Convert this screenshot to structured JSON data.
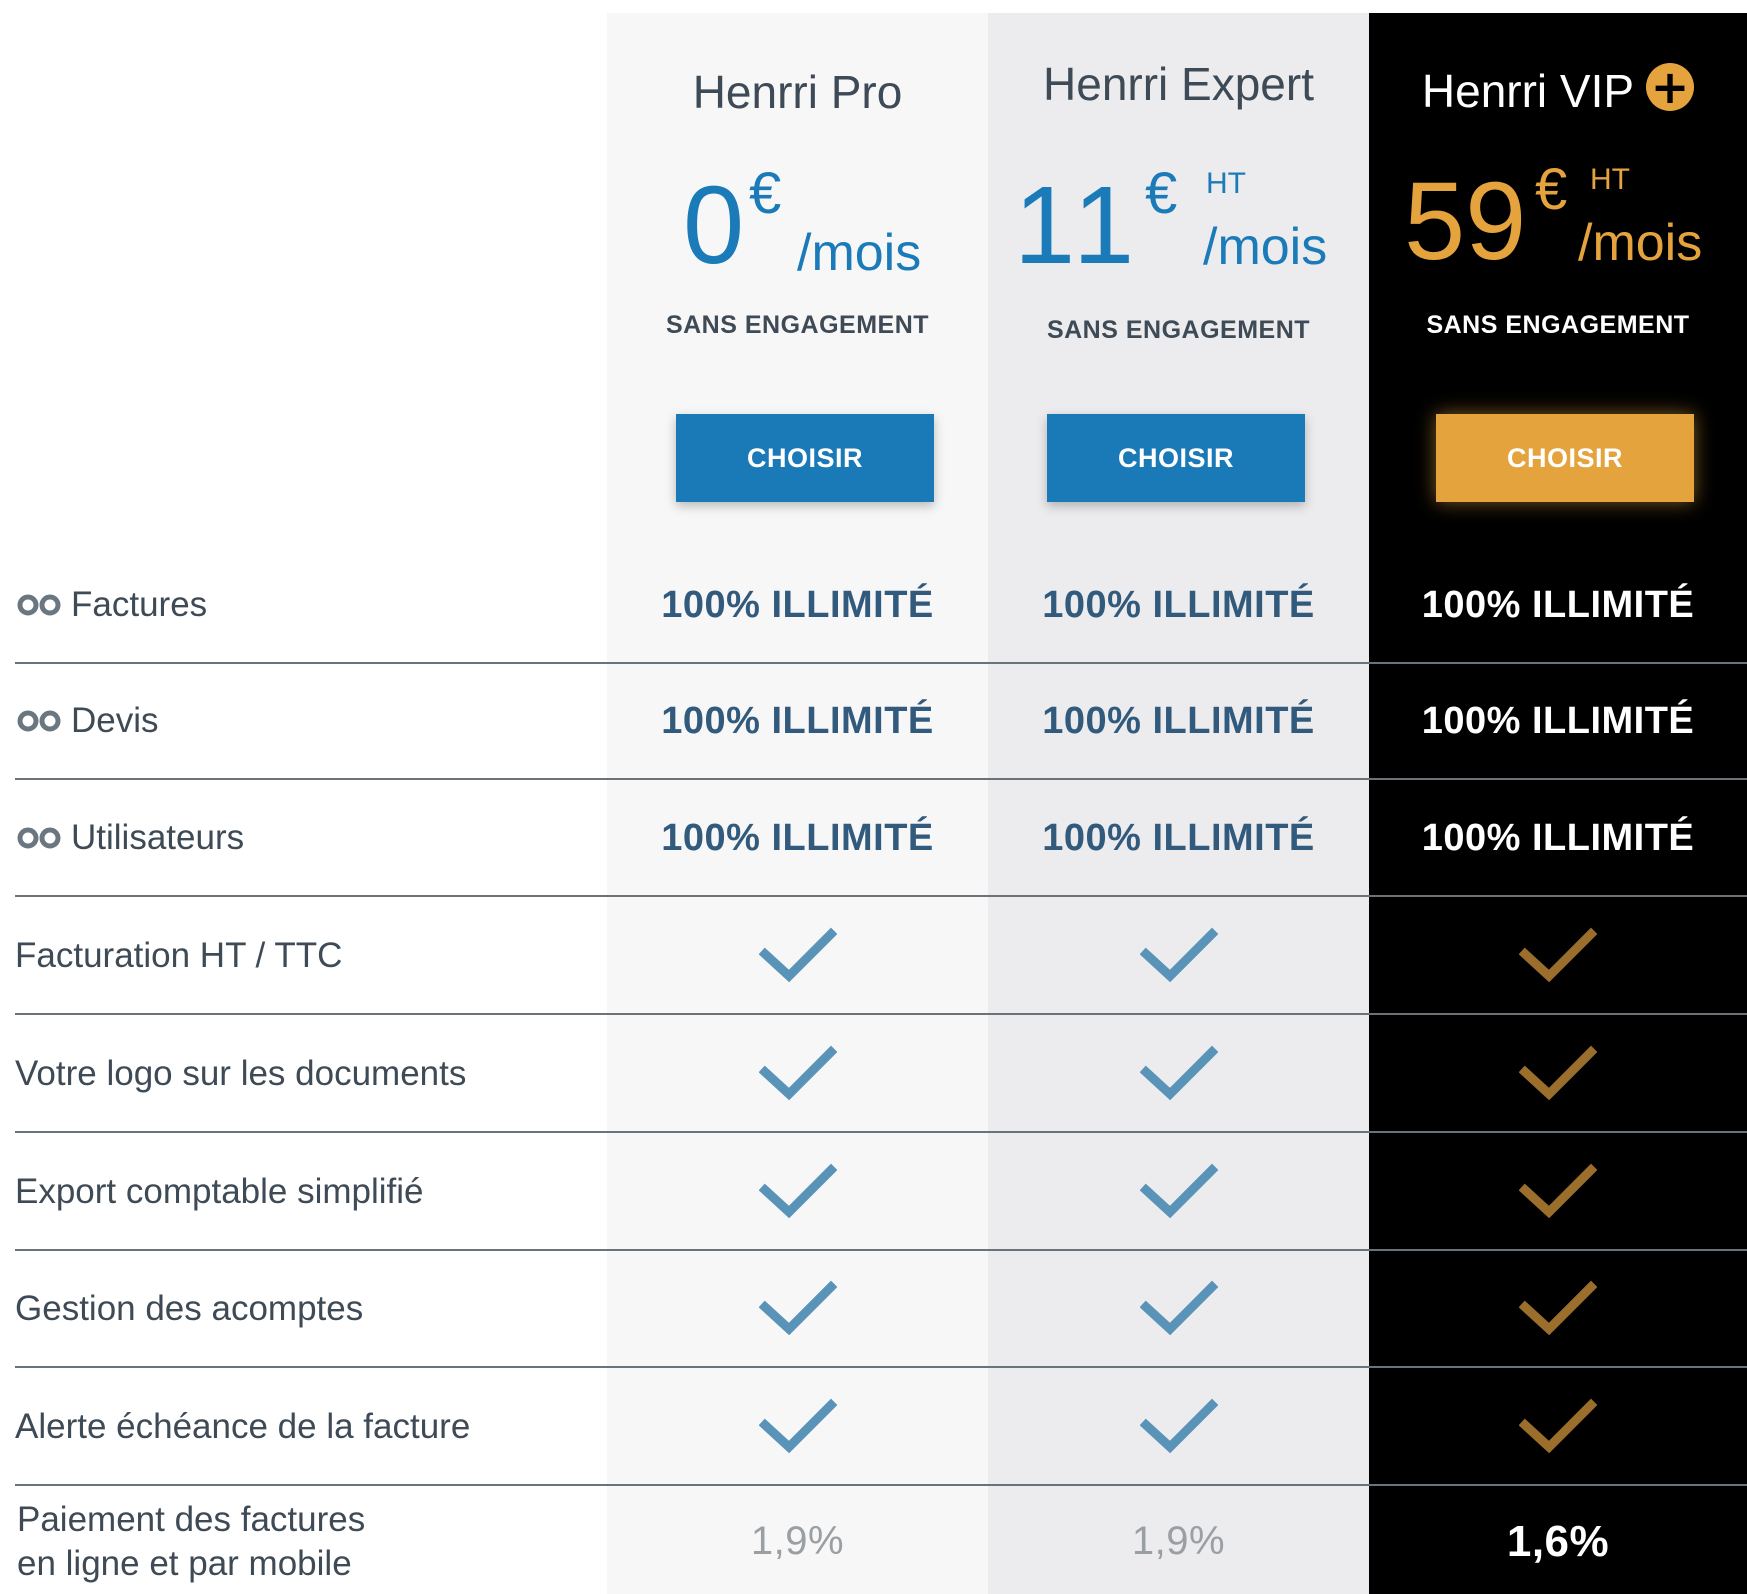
{
  "plans": [
    {
      "title": "Henrri Pro",
      "amount": "0",
      "currency": "€",
      "tax": "",
      "period": "/mois",
      "commitment": "SANS ENGAGEMENT",
      "cta": "CHOISIR"
    },
    {
      "title": "Henrri Expert",
      "amount": "11",
      "currency": "€",
      "tax": "HT",
      "period": "/mois",
      "commitment": "SANS ENGAGEMENT",
      "cta": "CHOISIR"
    },
    {
      "title": "Henrri VIP",
      "badge": "+",
      "amount": "59",
      "currency": "€",
      "tax": "HT",
      "period": "/mois",
      "commitment": "SANS ENGAGEMENT",
      "cta": "CHOISIR"
    }
  ],
  "features": [
    {
      "label": "Factures",
      "icon": "infinity-icon",
      "values": [
        "100% ILLIMITÉ",
        "100% ILLIMITÉ",
        "100% ILLIMITÉ"
      ]
    },
    {
      "label": "Devis",
      "icon": "infinity-icon",
      "values": [
        "100% ILLIMITÉ",
        "100% ILLIMITÉ",
        "100% ILLIMITÉ"
      ]
    },
    {
      "label": "Utilisateurs",
      "icon": "infinity-icon",
      "values": [
        "100% ILLIMITÉ",
        "100% ILLIMITÉ",
        "100% ILLIMITÉ"
      ]
    },
    {
      "label": "Facturation HT / TTC",
      "values": [
        "check",
        "check",
        "check"
      ]
    },
    {
      "label": "Votre logo sur les documents",
      "values": [
        "check",
        "check",
        "check"
      ]
    },
    {
      "label": "Export comptable simplifié",
      "values": [
        "check",
        "check",
        "check"
      ]
    },
    {
      "label": "Gestion des acomptes",
      "values": [
        "check",
        "check",
        "check"
      ]
    },
    {
      "label": "Alerte échéance de la facture",
      "values": [
        "check",
        "check",
        "check"
      ]
    }
  ],
  "payment": {
    "label_line1": "Paiement des factures",
    "label_line2": "en ligne et par mobile",
    "values": [
      "1,9%",
      "1,9%",
      "1,6%"
    ]
  },
  "colors": {
    "accent_blue": "#1a7ab8",
    "accent_gold": "#e4a33d",
    "check_blue": "#5a93b8",
    "check_gold": "#9b6e2c",
    "vip_background": "#000000"
  }
}
